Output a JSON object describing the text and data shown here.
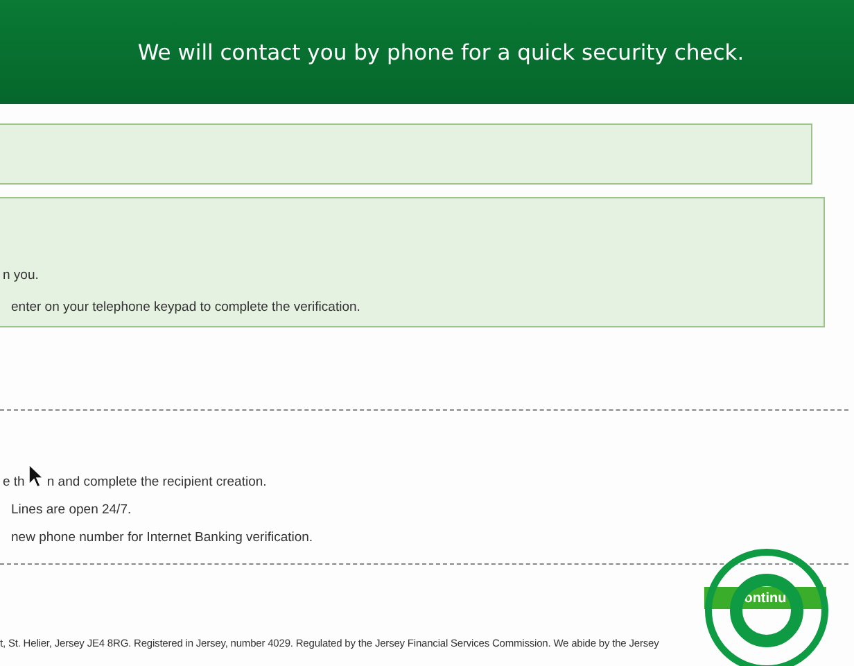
{
  "header": {
    "title": "We will contact you by phone for a quick security check."
  },
  "info_box": {
    "lines": [
      "n you.",
      "enter on your telephone keypad to complete the verification."
    ]
  },
  "instructions": [
    "e th",
    "n and complete the recipient creation.",
    "Lines are open 24/7.",
    "new phone number for Internet Banking verification."
  ],
  "continue_button": {
    "label": "ontinu"
  },
  "footer": {
    "text": "t, St. Helier, Jersey JE4 8RG. Registered in Jersey, number 4029. Regulated by the Jersey Financial Services Commission. We abide by the Jersey"
  }
}
